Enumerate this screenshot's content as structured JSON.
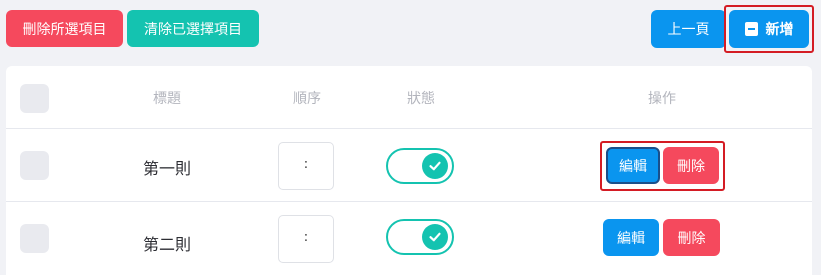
{
  "toolbar": {
    "delete_selected_label": "刪除所選項目",
    "clear_selected_label": "清除已選擇項目",
    "prev_page_label": "上一頁",
    "add_label": "新增"
  },
  "table": {
    "headers": {
      "title": "標題",
      "order": "順序",
      "status": "狀態",
      "actions": "操作"
    },
    "rows": [
      {
        "title": "第一則",
        "order_value": ":",
        "status_on": true,
        "edit_label": "編輯",
        "delete_label": "刪除"
      },
      {
        "title": "第二則",
        "order_value": ":",
        "status_on": true,
        "edit_label": "編輯",
        "delete_label": "刪除"
      }
    ]
  },
  "colors": {
    "red": "#f5495d",
    "teal": "#14c3b0",
    "blue": "#0a95ef",
    "highlight": "#d41c24"
  },
  "icons": {
    "add": "document-icon",
    "toggle_check": "check-icon"
  }
}
